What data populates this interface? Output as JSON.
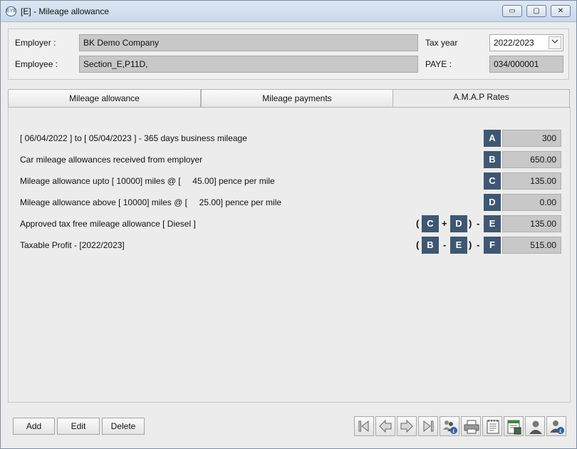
{
  "window": {
    "title": "[E] - Mileage allowance",
    "app_icon_text": "EYE",
    "min_glyph": "▭",
    "max_glyph": "▢",
    "close_glyph": "✕"
  },
  "header": {
    "employer_label": "Employer :",
    "employer_value": "BK Demo Company",
    "employee_label": "Employee :",
    "employee_value": "Section_E,P11D,",
    "tax_year_label": "Tax year",
    "tax_year_value": "2022/2023",
    "paye_label": "PAYE :",
    "paye_value": "034/000001"
  },
  "tabs": [
    {
      "label": "Mileage allowance"
    },
    {
      "label": "Mileage payments"
    },
    {
      "label": "A.M.A.P Rates"
    }
  ],
  "rows": [
    {
      "label": "[ 06/04/2022 ] to [ 05/04/2023 ] - 365 days business mileage",
      "badge": "A",
      "value": "300"
    },
    {
      "label": "Car mileage allowances received from employer",
      "badge": "B",
      "value": "650.00"
    },
    {
      "label": "Mileage allowance upto [ 10000] miles @ [     45.00] pence per mile",
      "badge": "C",
      "value": "135.00"
    },
    {
      "label": "Mileage allowance above [ 10000] miles @ [     25.00] pence per mile",
      "badge": "D",
      "value": "0.00"
    },
    {
      "label": "Approved tax free mileage allowance [ Diesel ]",
      "badge": "E",
      "value": "135.00"
    },
    {
      "label": "Taxable Profit - [2022/2023]",
      "badge": "F",
      "value": "515.00"
    }
  ],
  "formulas": {
    "e": {
      "open": "(",
      "left": "C",
      "op": "+",
      "right": "D",
      "close": ")",
      "dash": "-"
    },
    "f": {
      "open": "(",
      "left": "B",
      "op": "-",
      "right": "E",
      "close": ")",
      "dash": "-"
    }
  },
  "buttons": {
    "add": "Add",
    "edit": "Edit",
    "delete": "Delete"
  },
  "toolbar_icons": [
    "first-record-icon",
    "previous-record-icon",
    "next-record-icon",
    "last-record-icon",
    "employees-money-icon",
    "print-icon",
    "notes-icon",
    "calculator-sheet-icon",
    "user-icon",
    "user-money-icon"
  ]
}
